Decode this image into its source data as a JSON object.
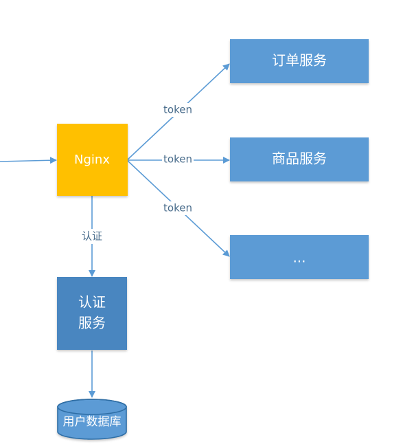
{
  "diagram": {
    "nodes": {
      "nginx": {
        "label": "Nginx",
        "color": "#ffc000"
      },
      "order_service": {
        "label": "订单服务",
        "color": "#5b9bd5"
      },
      "product_service": {
        "label": "商品服务",
        "color": "#5b9bd5"
      },
      "more_services": {
        "label": "...",
        "color": "#5b9bd5"
      },
      "auth_service": {
        "label_line1": "认证",
        "label_line2": "服务",
        "color": "#4a86c0"
      },
      "user_db": {
        "label": "用户数据库",
        "color": "#5b9bd5"
      }
    },
    "edges": {
      "token_order": {
        "label": "token"
      },
      "token_product": {
        "label": "token"
      },
      "token_more": {
        "label": "token"
      },
      "auth": {
        "label": "认证"
      }
    },
    "colors": {
      "edge": "#5b9bd5",
      "edge_label_text": "#4a6d8c"
    }
  }
}
